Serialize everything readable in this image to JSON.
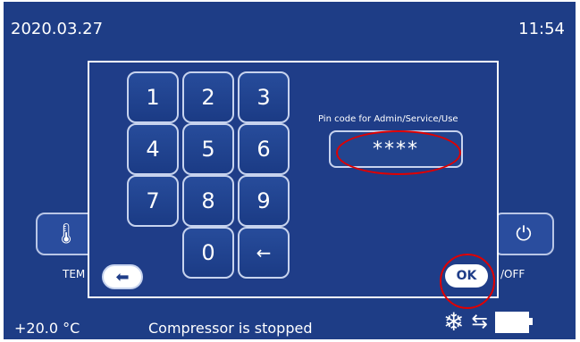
{
  "header": {
    "date": "2020.03.27",
    "time": "11:54"
  },
  "side_buttons": {
    "left_icon": "thermometer-icon",
    "left_label": "TEM",
    "right_icon": "power-icon",
    "right_label": "/OFF"
  },
  "dialog": {
    "keys": [
      "1",
      "2",
      "3",
      "4",
      "5",
      "6",
      "7",
      "8",
      "9",
      "",
      "0",
      "←"
    ],
    "pin_label": "Pin code for Admin/Service/Use",
    "pin_value": "****",
    "back_icon": "back-arrow-icon",
    "ok_label": "OK",
    "highlight_color": "#e00000"
  },
  "status": {
    "temperature": "+20.0 °C",
    "message": "Compressor is stopped",
    "icons": [
      "snowflake-icon",
      "usb-icon",
      "battery-icon"
    ]
  }
}
